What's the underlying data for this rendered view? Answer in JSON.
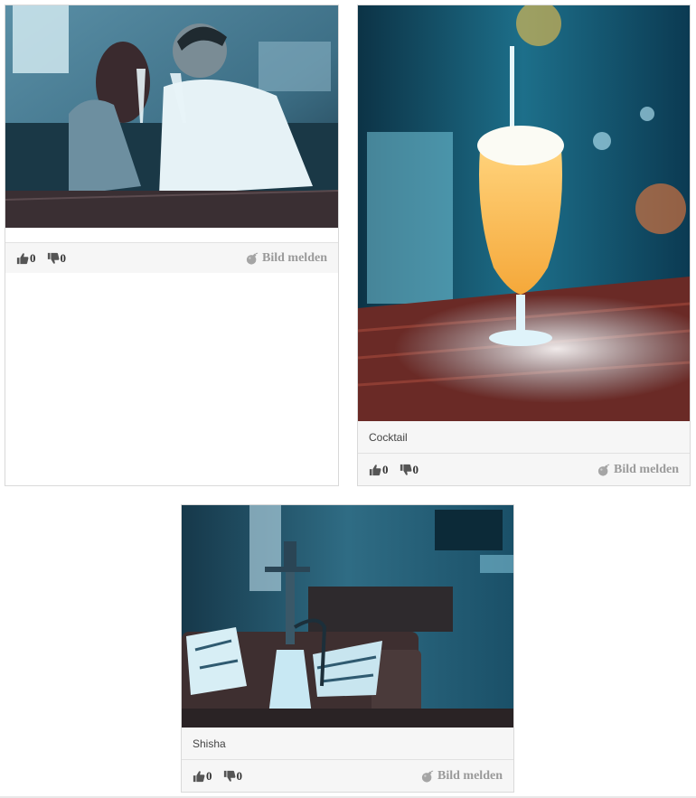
{
  "gallery": {
    "cards": [
      {
        "image_alt": "Couple toasting with champagne",
        "caption": "",
        "likes": "0",
        "dislikes": "0",
        "report_label": "Bild melden"
      },
      {
        "image_alt": "Cocktail",
        "caption": "Cocktail",
        "likes": "0",
        "dislikes": "0",
        "report_label": "Bild melden"
      },
      {
        "image_alt": "Shisha",
        "caption": "Shisha",
        "likes": "0",
        "dislikes": "0",
        "report_label": "Bild melden"
      }
    ]
  },
  "icons": {
    "like": "thumbs-up-icon",
    "dislike": "thumbs-down-icon",
    "report": "bomb-icon"
  },
  "colors": {
    "footer_bg": "#f6f6f6",
    "border": "#d9d9d9",
    "report_text": "#9a9a9a",
    "icon": "#555555"
  }
}
